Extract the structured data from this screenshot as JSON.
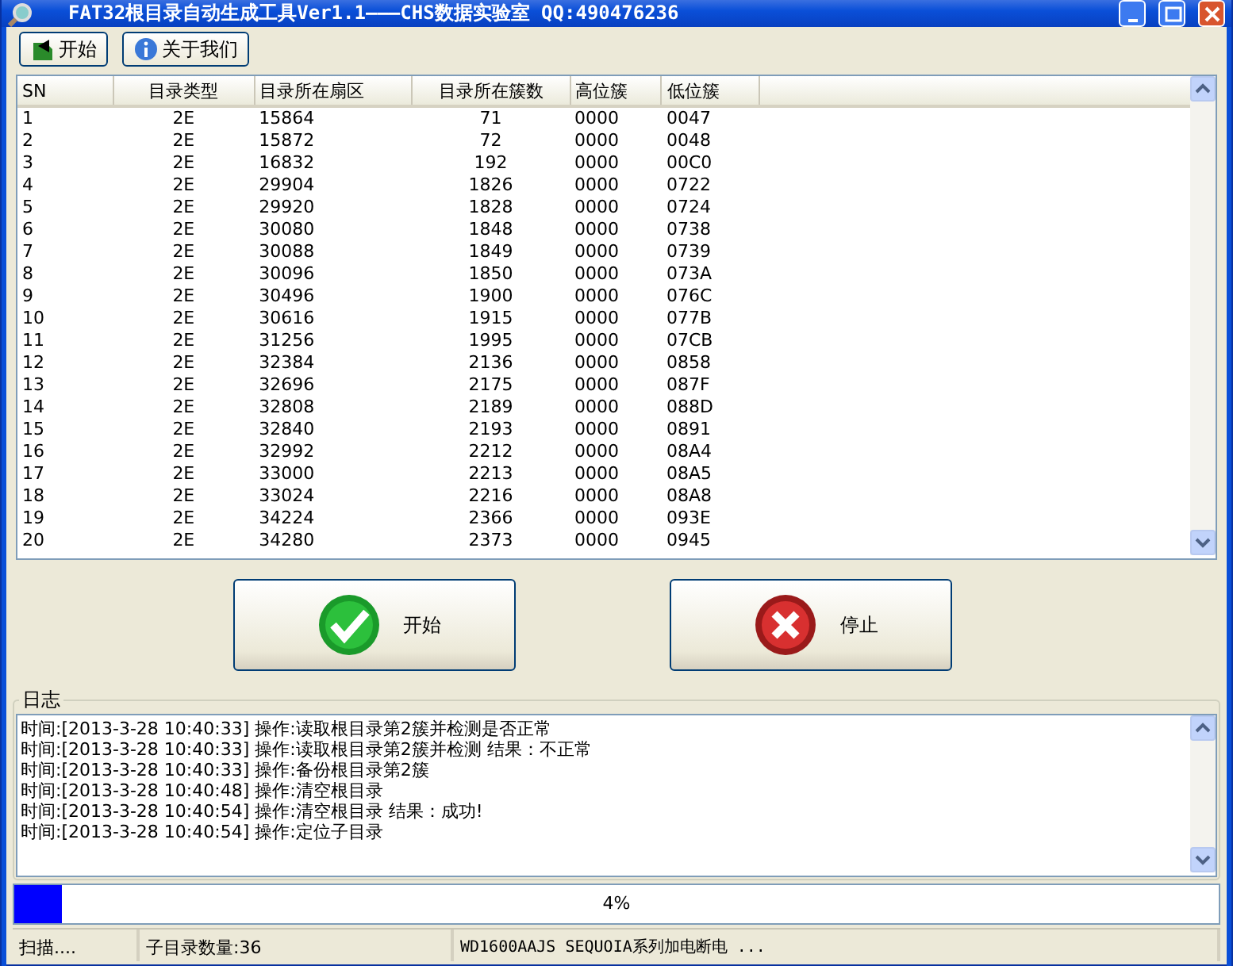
{
  "window": {
    "title": "FAT32根目录自动生成工具Ver1.1———CHS数据实验室 QQ:490476236"
  },
  "toolbar": [
    {
      "label": "开始",
      "kind": "start"
    },
    {
      "label": "关于我们",
      "kind": "info"
    }
  ],
  "table": {
    "columns": [
      "SN",
      "目录类型",
      "目录所在扇区",
      "目录所在簇数",
      "高位簇",
      "低位簇"
    ],
    "rows": [
      [
        "1",
        "2E",
        "15864",
        "71",
        "0000",
        "0047"
      ],
      [
        "2",
        "2E",
        "15872",
        "72",
        "0000",
        "0048"
      ],
      [
        "3",
        "2E",
        "16832",
        "192",
        "0000",
        "00C0"
      ],
      [
        "4",
        "2E",
        "29904",
        "1826",
        "0000",
        "0722"
      ],
      [
        "5",
        "2E",
        "29920",
        "1828",
        "0000",
        "0724"
      ],
      [
        "6",
        "2E",
        "30080",
        "1848",
        "0000",
        "0738"
      ],
      [
        "7",
        "2E",
        "30088",
        "1849",
        "0000",
        "0739"
      ],
      [
        "8",
        "2E",
        "30096",
        "1850",
        "0000",
        "073A"
      ],
      [
        "9",
        "2E",
        "30496",
        "1900",
        "0000",
        "076C"
      ],
      [
        "10",
        "2E",
        "30616",
        "1915",
        "0000",
        "077B"
      ],
      [
        "11",
        "2E",
        "31256",
        "1995",
        "0000",
        "07CB"
      ],
      [
        "12",
        "2E",
        "32384",
        "2136",
        "0000",
        "0858"
      ],
      [
        "13",
        "2E",
        "32696",
        "2175",
        "0000",
        "087F"
      ],
      [
        "14",
        "2E",
        "32808",
        "2189",
        "0000",
        "088D"
      ],
      [
        "15",
        "2E",
        "32840",
        "2193",
        "0000",
        "0891"
      ],
      [
        "16",
        "2E",
        "32992",
        "2212",
        "0000",
        "08A4"
      ],
      [
        "17",
        "2E",
        "33000",
        "2213",
        "0000",
        "08A5"
      ],
      [
        "18",
        "2E",
        "33024",
        "2216",
        "0000",
        "08A8"
      ],
      [
        "19",
        "2E",
        "34224",
        "2366",
        "0000",
        "093E"
      ],
      [
        "20",
        "2E",
        "34280",
        "2373",
        "0000",
        "0945"
      ]
    ]
  },
  "actions": [
    {
      "label": "开始",
      "kind": "ok"
    },
    {
      "label": "停止",
      "kind": "stop"
    }
  ],
  "log": {
    "title": "日志",
    "lines": [
      "时间:[2013-3-28 10:40:33] 操作:读取根目录第2簇并检测是否正常",
      "时间:[2013-3-28 10:40:33] 操作:读取根目录第2簇并检测  结果：不正常",
      "时间:[2013-3-28 10:40:33] 操作:备份根目录第2簇",
      "时间:[2013-3-28 10:40:48] 操作:清空根目录",
      "时间:[2013-3-28 10:40:54] 操作:清空根目录  结果：成功!",
      "时间:[2013-3-28 10:40:54] 操作:定位子目录"
    ]
  },
  "progress": {
    "level": 0.04,
    "reading": "4%"
  },
  "status_bar": [
    "扫描....",
    "子目录数量:36",
    "WD1600AAJS SEQUOIA系列加电断电 ..."
  ]
}
